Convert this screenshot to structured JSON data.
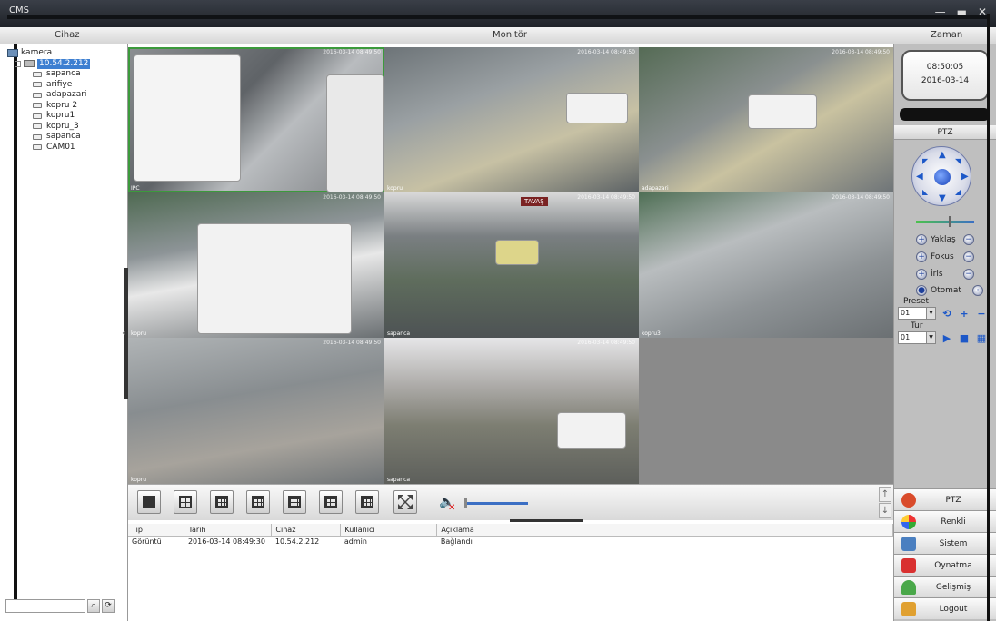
{
  "window": {
    "title": "CMS",
    "controls": [
      "—",
      "▬",
      "✕"
    ]
  },
  "header": {
    "device_label": "Cihaz",
    "monitor_label": "Monitör",
    "time_label": "Zaman"
  },
  "tree": {
    "root": "kamera",
    "server": "10.54.2.212",
    "cameras": [
      "sapanca",
      "arifiye",
      "adapazari",
      "kopru 2",
      "kopru1",
      "kopru_3",
      "sapanca",
      "CAM01"
    ]
  },
  "grid": {
    "cells": [
      {
        "stamp": "2016-03-14 08:49:50",
        "chan": "IPC"
      },
      {
        "stamp": "2016-03-14 08:49:50",
        "chan": "kopru"
      },
      {
        "stamp": "2016-03-14 08:49:50",
        "chan": "adapazari"
      },
      {
        "stamp": "2016-03-14 08:49:50",
        "chan": "kopru"
      },
      {
        "stamp": "2016-03-14 08:49:50",
        "chan": "sapanca",
        "sign": "TAVAŞ"
      },
      {
        "stamp": "2016-03-14 08:49:50",
        "chan": "kopru3"
      },
      {
        "stamp": "2016-03-14 08:49:50",
        "chan": "kopru"
      },
      {
        "stamp": "2016-03-14 08:49:50",
        "chan": "sapanca"
      }
    ]
  },
  "toolbar": {
    "up": "↑",
    "down": "↓"
  },
  "log": {
    "headers": [
      "Tip",
      "Tarih",
      "Cihaz",
      "Kullanıcı",
      "Açıklama",
      ""
    ],
    "rows": [
      [
        "Görüntü",
        "2016-03-14 08:49:30",
        "10.54.2.212",
        "admin",
        "Bağlandı",
        ""
      ]
    ]
  },
  "clock": {
    "time": "08:50:05",
    "date": "2016-03-14"
  },
  "ptz": {
    "title": "PTZ",
    "controls": [
      {
        "label": "Yaklaş"
      },
      {
        "label": "Fokus"
      },
      {
        "label": "İris"
      },
      {
        "label": "Otomat"
      }
    ],
    "preset_label": "Preset",
    "preset_value": "01",
    "tour_label": "Tur",
    "tour_value": "01"
  },
  "menu": [
    {
      "label": "PTZ",
      "color": "#d94b2b"
    },
    {
      "label": "Renkli",
      "color": "#3aa0e0"
    },
    {
      "label": "Sistem",
      "color": "#4a7fc0"
    },
    {
      "label": "Oynatma",
      "color": "#d93030"
    },
    {
      "label": "Gelişmiş",
      "color": "#4aa84a"
    },
    {
      "label": "Logout",
      "color": "#e0a030"
    }
  ]
}
